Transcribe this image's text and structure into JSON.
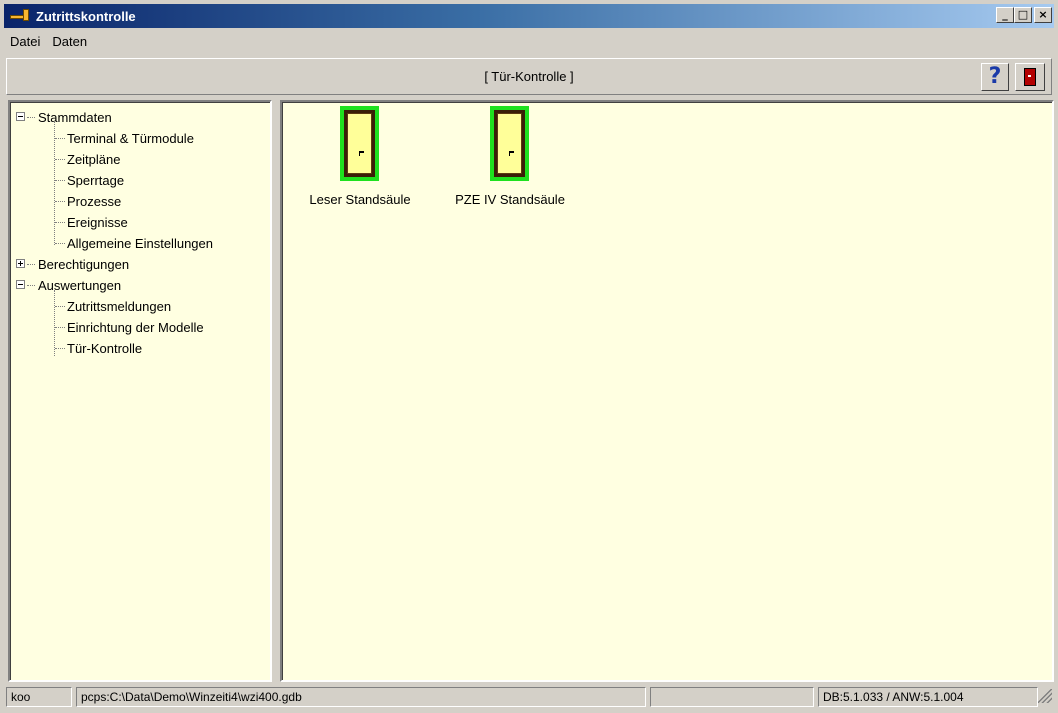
{
  "window": {
    "title": "Zutrittskontrolle",
    "buttons": {
      "minimize": "_",
      "maximize": "□",
      "close": "×"
    }
  },
  "menu": [
    "Datei",
    "Daten"
  ],
  "header": {
    "title": "[ Tür-Kontrolle ]",
    "help_glyph": "?"
  },
  "tree": {
    "stammdaten": {
      "label": "Stammdaten",
      "expanded": true,
      "children": [
        "Terminal & Türmodule",
        "Zeitpläne",
        "Sperrtage",
        "Prozesse",
        "Ereignisse",
        "Allgemeine Einstellungen"
      ]
    },
    "berechtigungen": {
      "label": "Berechtigungen",
      "expanded": false
    },
    "auswertungen": {
      "label": "Auswertungen",
      "expanded": true,
      "children": [
        "Zutrittsmeldungen",
        "Einrichtung der Modelle",
        "Tür-Kontrolle"
      ]
    }
  },
  "doors": [
    {
      "label": "Leser Standsäule",
      "status_color": "#1ee11e"
    },
    {
      "label": "PZE IV  Standsäule",
      "status_color": "#1ee11e"
    }
  ],
  "status": {
    "user": "koo",
    "database": "pcps:C:\\Data\\Demo\\Winzeiti4\\wzi400.gdb",
    "blank": "",
    "version": "DB:5.1.033 / ANW:5.1.004"
  },
  "colors": {
    "panel_background": "#ffffe1",
    "titlebar_start": "#0a246a",
    "titlebar_end": "#a6caf0"
  }
}
